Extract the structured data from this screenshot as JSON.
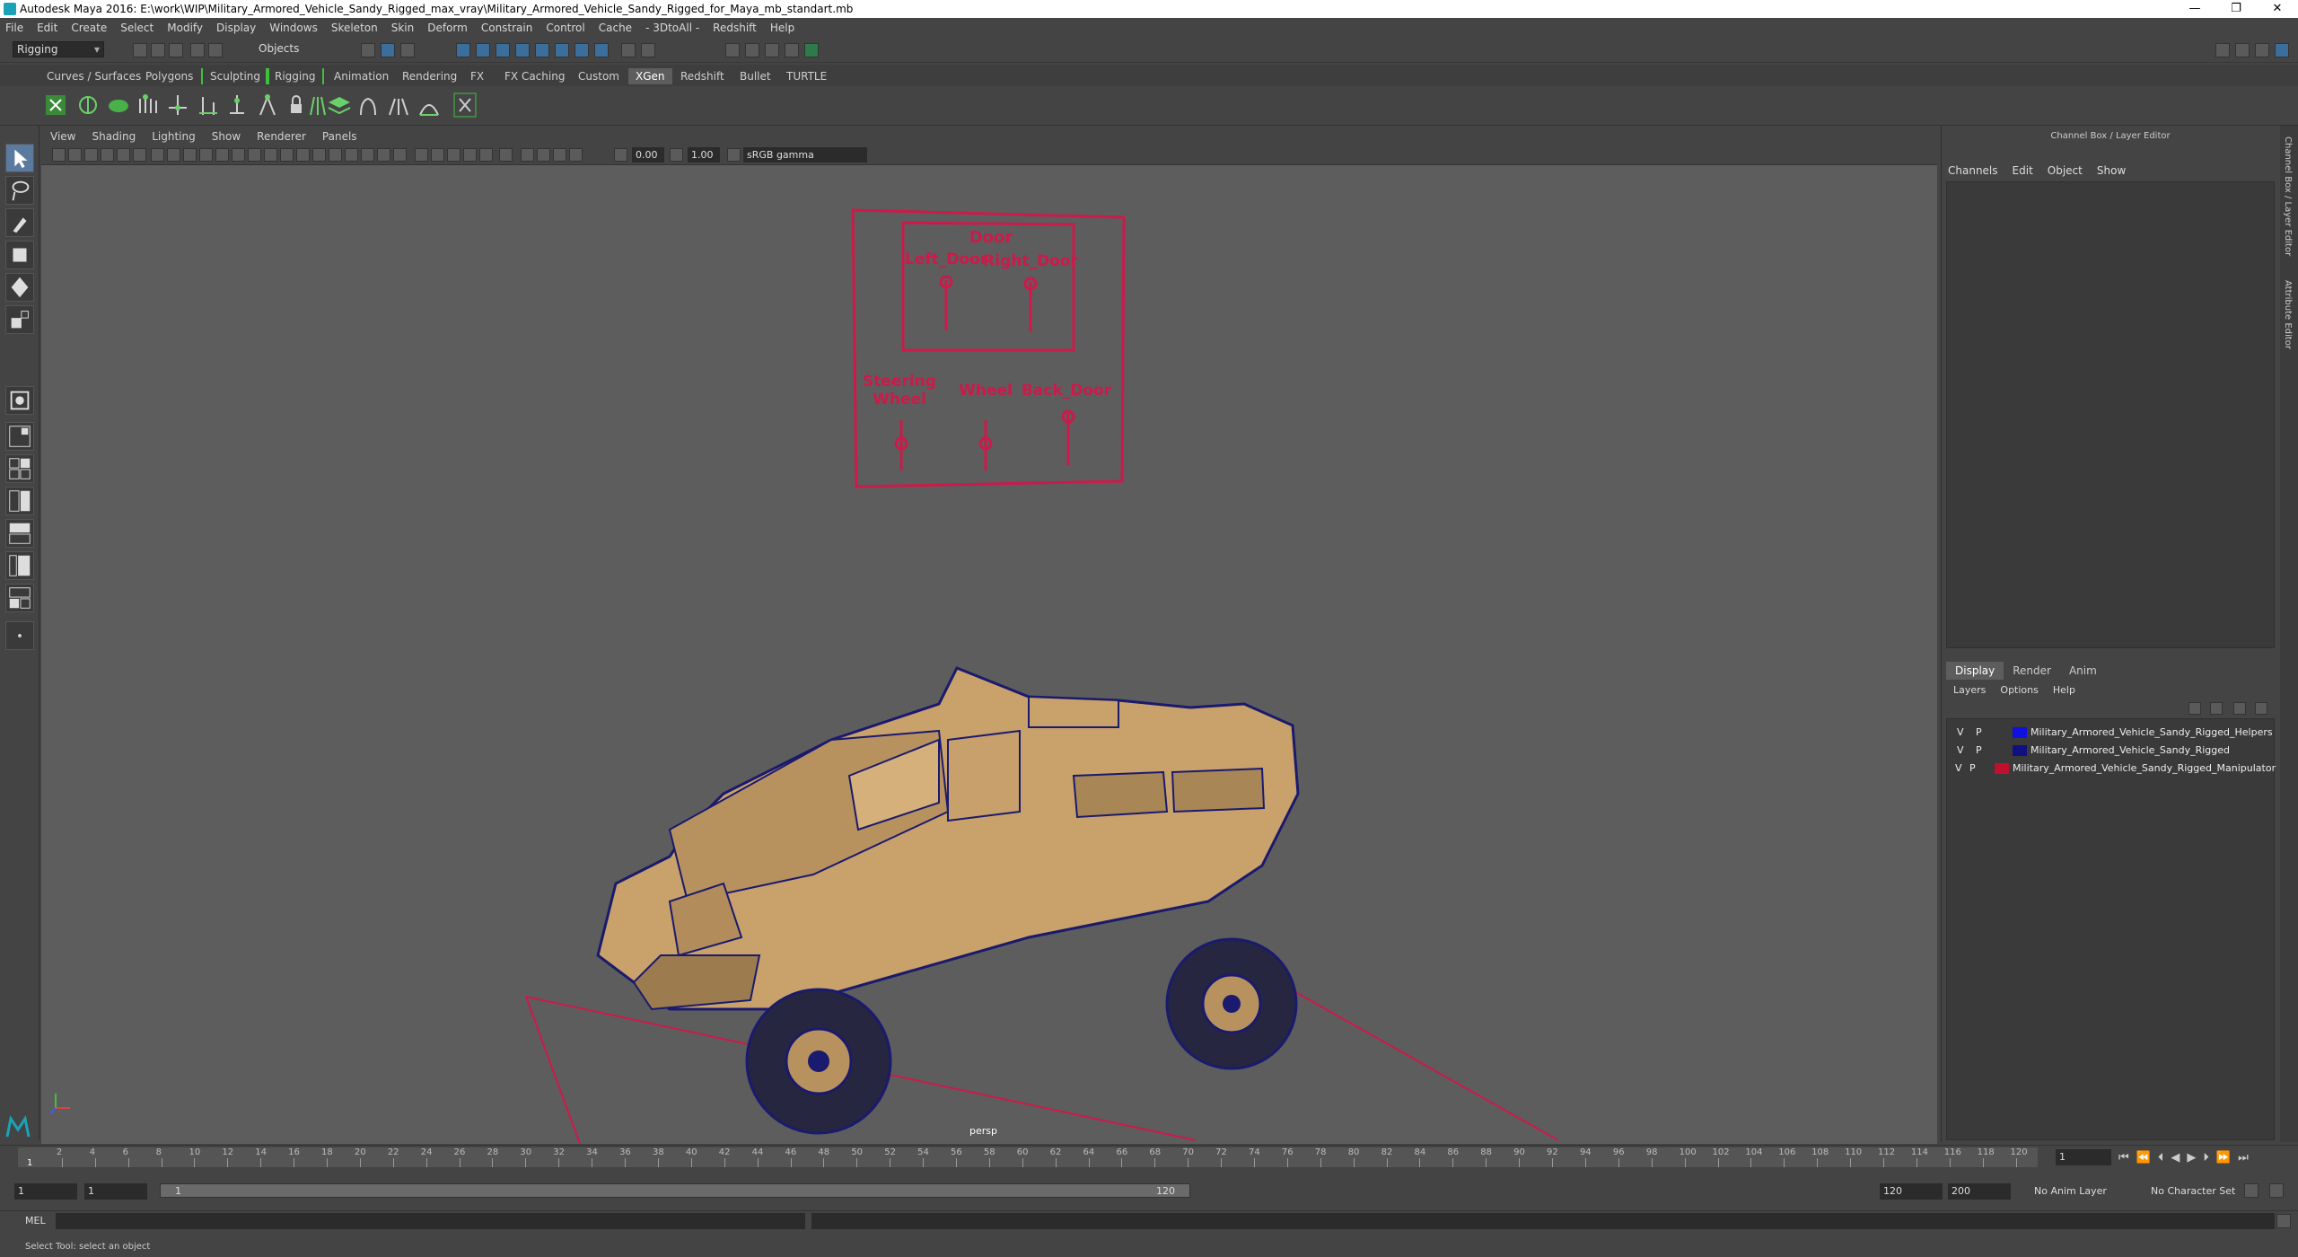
{
  "window": {
    "title": "Autodesk Maya 2016: E:\\work\\WIP\\Military_Armored_Vehicle_Sandy_Rigged_max_vray\\Military_Armored_Vehicle_Sandy_Rigged_for_Maya_mb_standart.mb",
    "minimize": "—",
    "restore": "❐",
    "close": "✕"
  },
  "menu": [
    "File",
    "Edit",
    "Create",
    "Select",
    "Modify",
    "Display",
    "Windows",
    "Skeleton",
    "Skin",
    "Deform",
    "Constrain",
    "Control",
    "Cache",
    "- 3DtoAll -",
    "Redshift",
    "Help"
  ],
  "status_line": {
    "mode": "Rigging",
    "objects_label": "Objects"
  },
  "shelf_tabs": [
    "Curves / Surfaces",
    "Polygons",
    "Sculpting",
    "Rigging",
    "Animation",
    "Rendering",
    "FX",
    "FX Caching",
    "Custom",
    "XGen",
    "Redshift",
    "Bullet",
    "TURTLE"
  ],
  "shelf_active": "XGen",
  "panel_menu": [
    "View",
    "Shading",
    "Lighting",
    "Show",
    "Renderer",
    "Panels"
  ],
  "panel_toolbar": {
    "near_value": "0.00",
    "far_value": "1.00",
    "color_space": "sRGB gamma"
  },
  "viewport": {
    "camera": "persp",
    "controls": {
      "door": "Door",
      "left_door": "Left_Door",
      "right_door": "Right_Door",
      "steering_wheel_1": "Steering",
      "steering_wheel_2": "Wheel",
      "wheel": "Wheel",
      "back_door": "Back_Door"
    },
    "control_color": "#cc1a4a",
    "vehicle_color": "#c9a16a",
    "wire_color": "#1a1a6e"
  },
  "timeline": {
    "ticks": [
      "2",
      "4",
      "6",
      "8",
      "10",
      "12",
      "14",
      "16",
      "18",
      "20",
      "22",
      "24",
      "26",
      "28",
      "30",
      "32",
      "34",
      "36",
      "38",
      "40",
      "42",
      "44",
      "46",
      "48",
      "50",
      "52",
      "54",
      "56",
      "58",
      "60",
      "62",
      "64",
      "66",
      "68",
      "70",
      "72",
      "74",
      "76",
      "78",
      "80",
      "82",
      "84",
      "86",
      "88",
      "90",
      "92",
      "94",
      "96",
      "98",
      "100",
      "102",
      "104",
      "106",
      "108",
      "110",
      "112",
      "114",
      "116",
      "118",
      "120"
    ],
    "current_frame": "1",
    "current_marker": "1"
  },
  "range": {
    "start": "1",
    "start_inner": "1",
    "slider_start": "1",
    "slider_end": "120",
    "end_inner": "120",
    "end": "200",
    "anim_layer": "No Anim Layer",
    "char_set": "No Character Set"
  },
  "command": {
    "lang": "MEL",
    "help": "Select Tool: select an object"
  },
  "channel_box": {
    "title": "Channel Box / Layer Editor",
    "menu": [
      "Channels",
      "Edit",
      "Object",
      "Show"
    ]
  },
  "layer_editor": {
    "tabs": [
      "Display",
      "Render",
      "Anim"
    ],
    "menu": [
      "Layers",
      "Options",
      "Help"
    ],
    "layers": [
      {
        "v": "V",
        "p": "P",
        "name": "Military_Armored_Vehicle_Sandy_Rigged_Helpers",
        "color": "#1010e0"
      },
      {
        "v": "V",
        "p": "P",
        "name": "Military_Armored_Vehicle_Sandy_Rigged",
        "color": "#101080"
      },
      {
        "v": "V",
        "p": "P",
        "name": "Military_Armored_Vehicle_Sandy_Rigged_Manipulator",
        "color": "#c01030"
      }
    ]
  },
  "side_tabs": [
    "Channel Box / Layer Editor",
    "Attribute Editor"
  ]
}
